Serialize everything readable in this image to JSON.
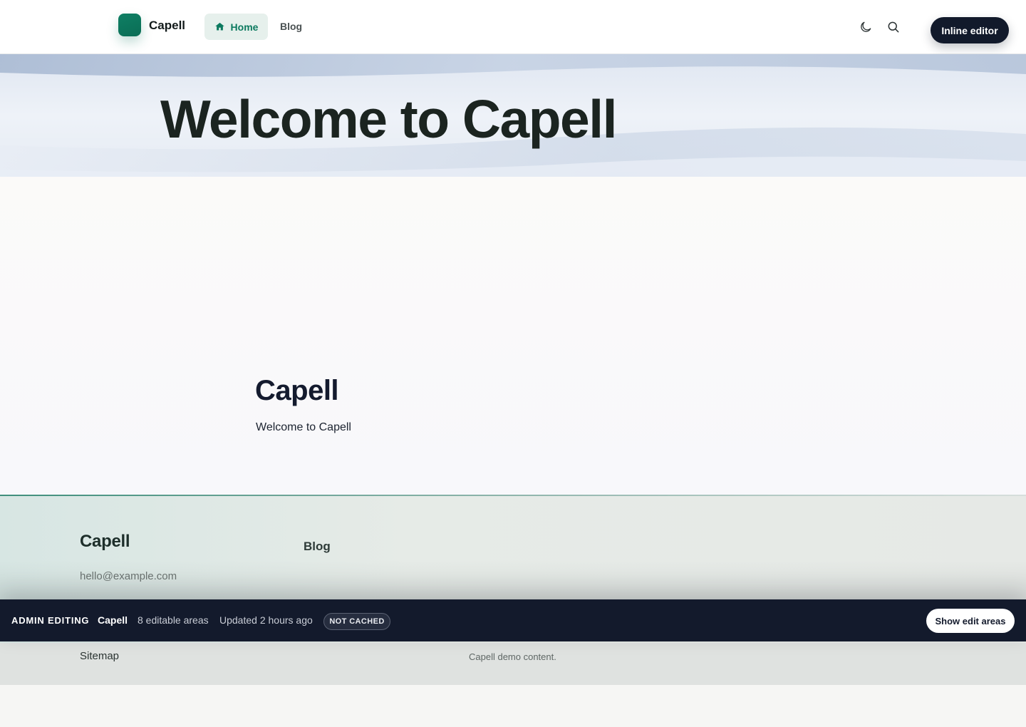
{
  "header": {
    "logo_text": "Capell",
    "nav": {
      "home_label": "Home",
      "blog_label": "Blog"
    },
    "inline_editor_label": "Inline editor"
  },
  "hero": {
    "title": "Welcome to Capell"
  },
  "content": {
    "title": "Capell",
    "subtitle": "Welcome to Capell"
  },
  "footer": {
    "brand": "Capell",
    "email": "hello@example.com",
    "blog_link": "Blog",
    "sitemap_link": "Sitemap",
    "copy": "Capell demo content."
  },
  "admin_bar": {
    "label": "ADMIN EDITING",
    "site": "Capell",
    "editable_areas": "8 editable areas",
    "updated": "Updated 2 hours ago",
    "cache_badge": "NOT CACHED",
    "show_edit_label": "Show edit areas"
  },
  "colors": {
    "accent": "#0c7a5f",
    "admin_bar_bg": "#131a2c",
    "hero_bg": "#e8eef6"
  },
  "icons": {
    "home": "home-icon",
    "theme": "moon-icon",
    "search": "search-icon"
  }
}
